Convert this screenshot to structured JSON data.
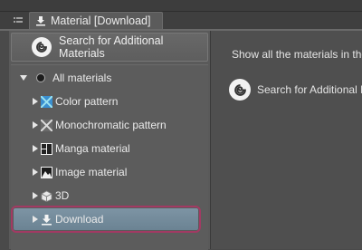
{
  "panel": {
    "tab_title": "Material [Download]"
  },
  "left": {
    "search_button_label": "Search for Additional Materials",
    "tree": [
      {
        "label": "All materials",
        "icon": "dot-icon",
        "expanded": true
      },
      {
        "label": "Color pattern",
        "icon": "color-pattern-icon"
      },
      {
        "label": "Monochromatic pattern",
        "icon": "monochromatic-pattern-icon"
      },
      {
        "label": "Manga material",
        "icon": "manga-material-icon"
      },
      {
        "label": "Image material",
        "icon": "image-material-icon"
      },
      {
        "label": "3D",
        "icon": "3d-icon"
      },
      {
        "label": "Download",
        "icon": "download-icon",
        "selected": true
      }
    ]
  },
  "right": {
    "description": "Show all the materials in the",
    "search_link": "Search for Additional M"
  },
  "colors": {
    "selection_highlight": "#6b8393",
    "callout_border": "#a23a63"
  }
}
